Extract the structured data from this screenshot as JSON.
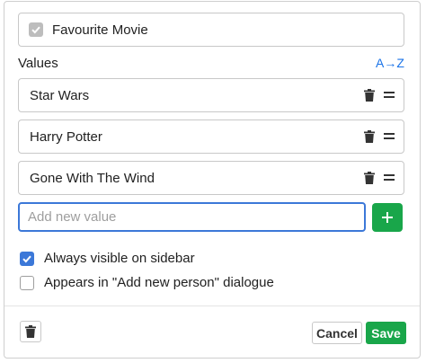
{
  "field": {
    "checked": true,
    "name": "Favourite Movie"
  },
  "values_section": {
    "label": "Values",
    "sort_label": "A→Z",
    "items": [
      {
        "label": "Star Wars"
      },
      {
        "label": "Harry Potter"
      },
      {
        "label": "Gone With The Wind"
      }
    ]
  },
  "new_value": {
    "placeholder": "Add new value",
    "value": ""
  },
  "add_button": {
    "icon": "plus-icon"
  },
  "options": [
    {
      "label": "Always visible on sidebar",
      "checked": true
    },
    {
      "label": "Appears in \"Add new person\" dialogue",
      "checked": false
    }
  ],
  "footer": {
    "delete_icon": "trash-icon",
    "cancel_label": "Cancel",
    "save_label": "Save"
  },
  "colors": {
    "accent_blue": "#3c78d8",
    "link_blue": "#1a73e8",
    "green": "#19a64a",
    "border": "#c8c8c8"
  }
}
